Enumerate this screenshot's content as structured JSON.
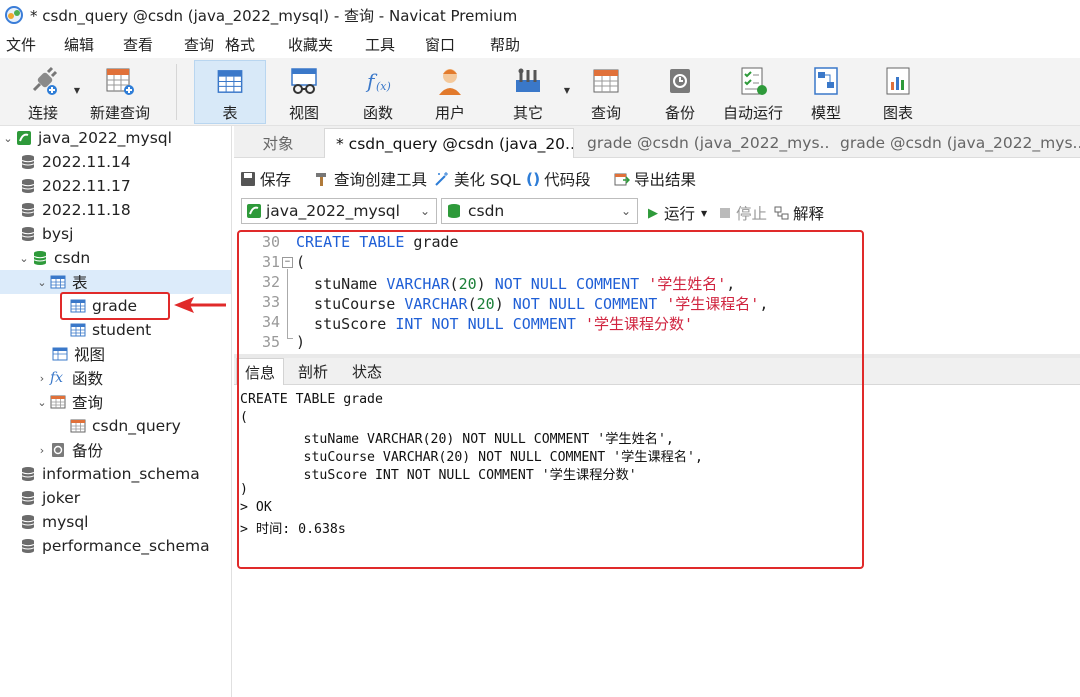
{
  "window": {
    "title": "* csdn_query @csdn (java_2022_mysql) - 查询 - Navicat Premium"
  },
  "menu": [
    "文件",
    "编辑",
    "查看",
    "查询",
    "格式",
    "收藏夹",
    "工具",
    "窗口",
    "帮助"
  ],
  "toolbar": {
    "connect": "连接",
    "new_query": "新建查询",
    "table": "表",
    "view": "视图",
    "function": "函数",
    "user": "用户",
    "other": "其它",
    "query": "查询",
    "backup": "备份",
    "auto_run": "自动运行",
    "model": "模型",
    "chart": "图表"
  },
  "tree": {
    "connection": "java_2022_mysql",
    "db1": "2022.11.14",
    "db2": "2022.11.17",
    "db3": "2022.11.18",
    "db4": "bysj",
    "db5": "csdn",
    "tables_folder": "表",
    "table1": "grade",
    "table2": "student",
    "views_folder": "视图",
    "functions_folder": "函数",
    "queries_folder": "查询",
    "query1": "csdn_query",
    "backups_folder": "备份",
    "db6": "information_schema",
    "db7": "joker",
    "db8": "mysql",
    "db9": "performance_schema"
  },
  "tabs": {
    "objects": "对象",
    "tab1": "* csdn_query @csdn (java_20...",
    "tab2": "grade @csdn (java_2022_mys...",
    "tab3": "grade @csdn (java_2022_mys..."
  },
  "query_toolbar": {
    "save": "保存",
    "builder": "查询创建工具",
    "beautify": "美化 SQL",
    "snippet": "代码段",
    "export": "导出结果"
  },
  "connection_bar": {
    "connection_value": "java_2022_mysql",
    "database_value": "csdn",
    "run": "运行",
    "stop": "停止",
    "explain": "解释"
  },
  "editor": {
    "line_numbers": [
      "30",
      "31",
      "32",
      "33",
      "34",
      "35"
    ],
    "l30_kw": "CREATE TABLE",
    "l30_rest": " grade",
    "l31": "(",
    "l32_a": "  stuName ",
    "l32_type": "VARCHAR",
    "l32_p1": "(",
    "l32_num": "20",
    "l32_p2": ") ",
    "l32_kw": "NOT NULL COMMENT",
    "l32_str": " '学生姓名'",
    "l32_end": ",",
    "l33_a": "  stuCourse ",
    "l33_type": "VARCHAR",
    "l33_p1": "(",
    "l33_num": "20",
    "l33_p2": ") ",
    "l33_kw": "NOT NULL COMMENT",
    "l33_str": " '学生课程名'",
    "l33_end": ",",
    "l34_a": "  stuScore ",
    "l34_kw": "INT NOT NULL COMMENT",
    "l34_str": " '学生课程分数'",
    "l35": ")"
  },
  "result_tabs": {
    "info": "信息",
    "profile": "剖析",
    "status": "状态"
  },
  "result_lines": [
    "CREATE TABLE grade",
    "(",
    "        stuName VARCHAR(20) NOT NULL COMMENT '学生姓名',",
    "        stuCourse VARCHAR(20) NOT NULL COMMENT '学生课程名',",
    "        stuScore INT NOT NULL COMMENT '学生课程分数'",
    ")",
    "> OK",
    "> 时间: 0.638s"
  ],
  "colors": {
    "accent": "#1f5fd6",
    "string": "#d0243f",
    "number": "#1a7f37",
    "highlight": "#e02a2a",
    "selection": "#dcebfa"
  }
}
